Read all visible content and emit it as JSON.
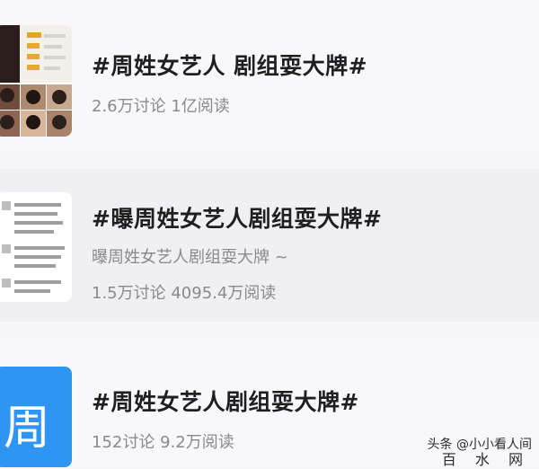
{
  "topics": [
    {
      "title": "#周姓女艺人 剧组耍大牌#",
      "description": "",
      "stats": "2.6万讨论 1亿阅读"
    },
    {
      "title": "#曝周姓女艺人剧组耍大牌#",
      "description": "曝周姓女艺人剧组耍大牌 ~",
      "stats": "1.5万讨论 4095.4万阅读"
    },
    {
      "title": "#周姓女艺人剧组耍大牌#",
      "description": "",
      "stats": "152讨论 9.2万阅读",
      "thumb_char": "周"
    }
  ],
  "watermark": {
    "line1": "头条 @小小看人间",
    "line2": "百 水 网"
  },
  "colors": {
    "title": "#1f1f1f",
    "meta": "#8a8a8a",
    "accent_blue": "#2f95f3"
  }
}
